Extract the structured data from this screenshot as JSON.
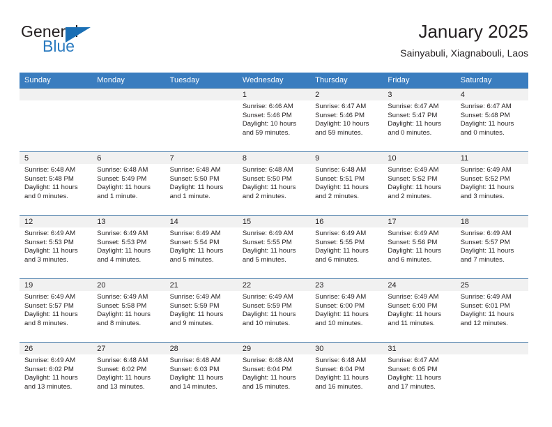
{
  "brand": {
    "name_top": "General",
    "name_bottom": "Blue",
    "triangle_color": "#1a6fb5",
    "blue_color": "#2b7bc0"
  },
  "header": {
    "title": "January 2025",
    "subtitle": "Sainyabuli, Xiagnabouli, Laos"
  },
  "theme": {
    "header_row_bg": "#3a7dbf",
    "daynum_band_bg": "#f1f1f1",
    "row_divider": "#4b7eab",
    "text": "#231f20"
  },
  "weekday_headers": [
    "Sunday",
    "Monday",
    "Tuesday",
    "Wednesday",
    "Thursday",
    "Friday",
    "Saturday"
  ],
  "weeks": [
    [
      {
        "day": "",
        "empty": true
      },
      {
        "day": "",
        "empty": true
      },
      {
        "day": "",
        "empty": true
      },
      {
        "day": "1",
        "sunrise": "Sunrise: 6:46 AM",
        "sunset": "Sunset: 5:46 PM",
        "daylight": "Daylight: 10 hours and 59 minutes."
      },
      {
        "day": "2",
        "sunrise": "Sunrise: 6:47 AM",
        "sunset": "Sunset: 5:46 PM",
        "daylight": "Daylight: 10 hours and 59 minutes."
      },
      {
        "day": "3",
        "sunrise": "Sunrise: 6:47 AM",
        "sunset": "Sunset: 5:47 PM",
        "daylight": "Daylight: 11 hours and 0 minutes."
      },
      {
        "day": "4",
        "sunrise": "Sunrise: 6:47 AM",
        "sunset": "Sunset: 5:48 PM",
        "daylight": "Daylight: 11 hours and 0 minutes."
      }
    ],
    [
      {
        "day": "5",
        "sunrise": "Sunrise: 6:48 AM",
        "sunset": "Sunset: 5:48 PM",
        "daylight": "Daylight: 11 hours and 0 minutes."
      },
      {
        "day": "6",
        "sunrise": "Sunrise: 6:48 AM",
        "sunset": "Sunset: 5:49 PM",
        "daylight": "Daylight: 11 hours and 1 minute."
      },
      {
        "day": "7",
        "sunrise": "Sunrise: 6:48 AM",
        "sunset": "Sunset: 5:50 PM",
        "daylight": "Daylight: 11 hours and 1 minute."
      },
      {
        "day": "8",
        "sunrise": "Sunrise: 6:48 AM",
        "sunset": "Sunset: 5:50 PM",
        "daylight": "Daylight: 11 hours and 2 minutes."
      },
      {
        "day": "9",
        "sunrise": "Sunrise: 6:48 AM",
        "sunset": "Sunset: 5:51 PM",
        "daylight": "Daylight: 11 hours and 2 minutes."
      },
      {
        "day": "10",
        "sunrise": "Sunrise: 6:49 AM",
        "sunset": "Sunset: 5:52 PM",
        "daylight": "Daylight: 11 hours and 2 minutes."
      },
      {
        "day": "11",
        "sunrise": "Sunrise: 6:49 AM",
        "sunset": "Sunset: 5:52 PM",
        "daylight": "Daylight: 11 hours and 3 minutes."
      }
    ],
    [
      {
        "day": "12",
        "sunrise": "Sunrise: 6:49 AM",
        "sunset": "Sunset: 5:53 PM",
        "daylight": "Daylight: 11 hours and 3 minutes."
      },
      {
        "day": "13",
        "sunrise": "Sunrise: 6:49 AM",
        "sunset": "Sunset: 5:53 PM",
        "daylight": "Daylight: 11 hours and 4 minutes."
      },
      {
        "day": "14",
        "sunrise": "Sunrise: 6:49 AM",
        "sunset": "Sunset: 5:54 PM",
        "daylight": "Daylight: 11 hours and 5 minutes."
      },
      {
        "day": "15",
        "sunrise": "Sunrise: 6:49 AM",
        "sunset": "Sunset: 5:55 PM",
        "daylight": "Daylight: 11 hours and 5 minutes."
      },
      {
        "day": "16",
        "sunrise": "Sunrise: 6:49 AM",
        "sunset": "Sunset: 5:55 PM",
        "daylight": "Daylight: 11 hours and 6 minutes."
      },
      {
        "day": "17",
        "sunrise": "Sunrise: 6:49 AM",
        "sunset": "Sunset: 5:56 PM",
        "daylight": "Daylight: 11 hours and 6 minutes."
      },
      {
        "day": "18",
        "sunrise": "Sunrise: 6:49 AM",
        "sunset": "Sunset: 5:57 PM",
        "daylight": "Daylight: 11 hours and 7 minutes."
      }
    ],
    [
      {
        "day": "19",
        "sunrise": "Sunrise: 6:49 AM",
        "sunset": "Sunset: 5:57 PM",
        "daylight": "Daylight: 11 hours and 8 minutes."
      },
      {
        "day": "20",
        "sunrise": "Sunrise: 6:49 AM",
        "sunset": "Sunset: 5:58 PM",
        "daylight": "Daylight: 11 hours and 8 minutes."
      },
      {
        "day": "21",
        "sunrise": "Sunrise: 6:49 AM",
        "sunset": "Sunset: 5:59 PM",
        "daylight": "Daylight: 11 hours and 9 minutes."
      },
      {
        "day": "22",
        "sunrise": "Sunrise: 6:49 AM",
        "sunset": "Sunset: 5:59 PM",
        "daylight": "Daylight: 11 hours and 10 minutes."
      },
      {
        "day": "23",
        "sunrise": "Sunrise: 6:49 AM",
        "sunset": "Sunset: 6:00 PM",
        "daylight": "Daylight: 11 hours and 10 minutes."
      },
      {
        "day": "24",
        "sunrise": "Sunrise: 6:49 AM",
        "sunset": "Sunset: 6:00 PM",
        "daylight": "Daylight: 11 hours and 11 minutes."
      },
      {
        "day": "25",
        "sunrise": "Sunrise: 6:49 AM",
        "sunset": "Sunset: 6:01 PM",
        "daylight": "Daylight: 11 hours and 12 minutes."
      }
    ],
    [
      {
        "day": "26",
        "sunrise": "Sunrise: 6:49 AM",
        "sunset": "Sunset: 6:02 PM",
        "daylight": "Daylight: 11 hours and 13 minutes."
      },
      {
        "day": "27",
        "sunrise": "Sunrise: 6:48 AM",
        "sunset": "Sunset: 6:02 PM",
        "daylight": "Daylight: 11 hours and 13 minutes."
      },
      {
        "day": "28",
        "sunrise": "Sunrise: 6:48 AM",
        "sunset": "Sunset: 6:03 PM",
        "daylight": "Daylight: 11 hours and 14 minutes."
      },
      {
        "day": "29",
        "sunrise": "Sunrise: 6:48 AM",
        "sunset": "Sunset: 6:04 PM",
        "daylight": "Daylight: 11 hours and 15 minutes."
      },
      {
        "day": "30",
        "sunrise": "Sunrise: 6:48 AM",
        "sunset": "Sunset: 6:04 PM",
        "daylight": "Daylight: 11 hours and 16 minutes."
      },
      {
        "day": "31",
        "sunrise": "Sunrise: 6:47 AM",
        "sunset": "Sunset: 6:05 PM",
        "daylight": "Daylight: 11 hours and 17 minutes."
      },
      {
        "day": "",
        "empty": true
      }
    ]
  ]
}
